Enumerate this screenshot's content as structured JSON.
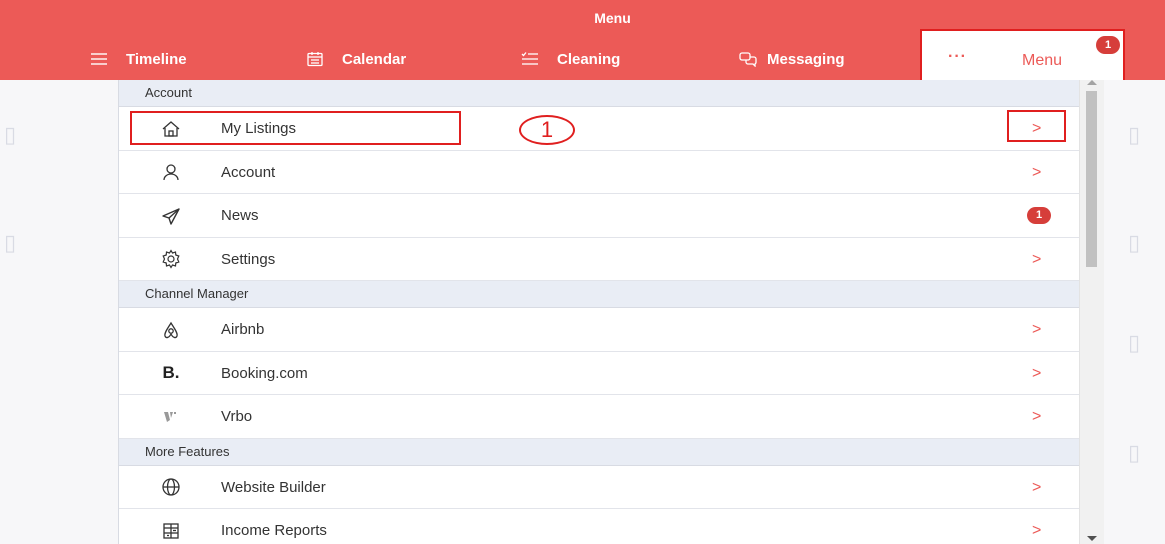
{
  "header": {
    "title": "Menu",
    "nav": [
      {
        "label": "Timeline",
        "icon": "timeline-icon"
      },
      {
        "label": "Calendar",
        "icon": "calendar-icon"
      },
      {
        "label": "Cleaning",
        "icon": "cleaning-icon"
      },
      {
        "label": "Messaging",
        "icon": "messaging-icon"
      }
    ],
    "menu_tab": {
      "dots": "···",
      "label": "Menu",
      "badge": "1"
    }
  },
  "sections": [
    {
      "title": "Account",
      "items": [
        {
          "label": "My Listings",
          "icon": "home-icon",
          "trailing": ">"
        },
        {
          "label": "Account",
          "icon": "user-icon",
          "trailing": ">"
        },
        {
          "label": "News",
          "icon": "send-icon",
          "badge": "1"
        },
        {
          "label": "Settings",
          "icon": "gear-icon",
          "trailing": ">"
        }
      ]
    },
    {
      "title": "Channel Manager",
      "items": [
        {
          "label": "Airbnb",
          "icon": "airbnb-icon",
          "trailing": ">"
        },
        {
          "label": "Booking.com",
          "icon": "booking-icon",
          "icon_text": "B.",
          "trailing": ">"
        },
        {
          "label": "Vrbo",
          "icon": "vrbo-icon",
          "trailing": ">"
        }
      ]
    },
    {
      "title": "More Features",
      "items": [
        {
          "label": "Website Builder",
          "icon": "globe-icon",
          "trailing": ">"
        },
        {
          "label": "Income Reports",
          "icon": "report-icon",
          "trailing": ">"
        }
      ]
    }
  ],
  "annotation": {
    "step": "1"
  },
  "colors": {
    "brand": "#ec5a57",
    "highlight": "#e01f1f",
    "badge": "#d63e3a",
    "section_bg": "#e9edf5"
  }
}
